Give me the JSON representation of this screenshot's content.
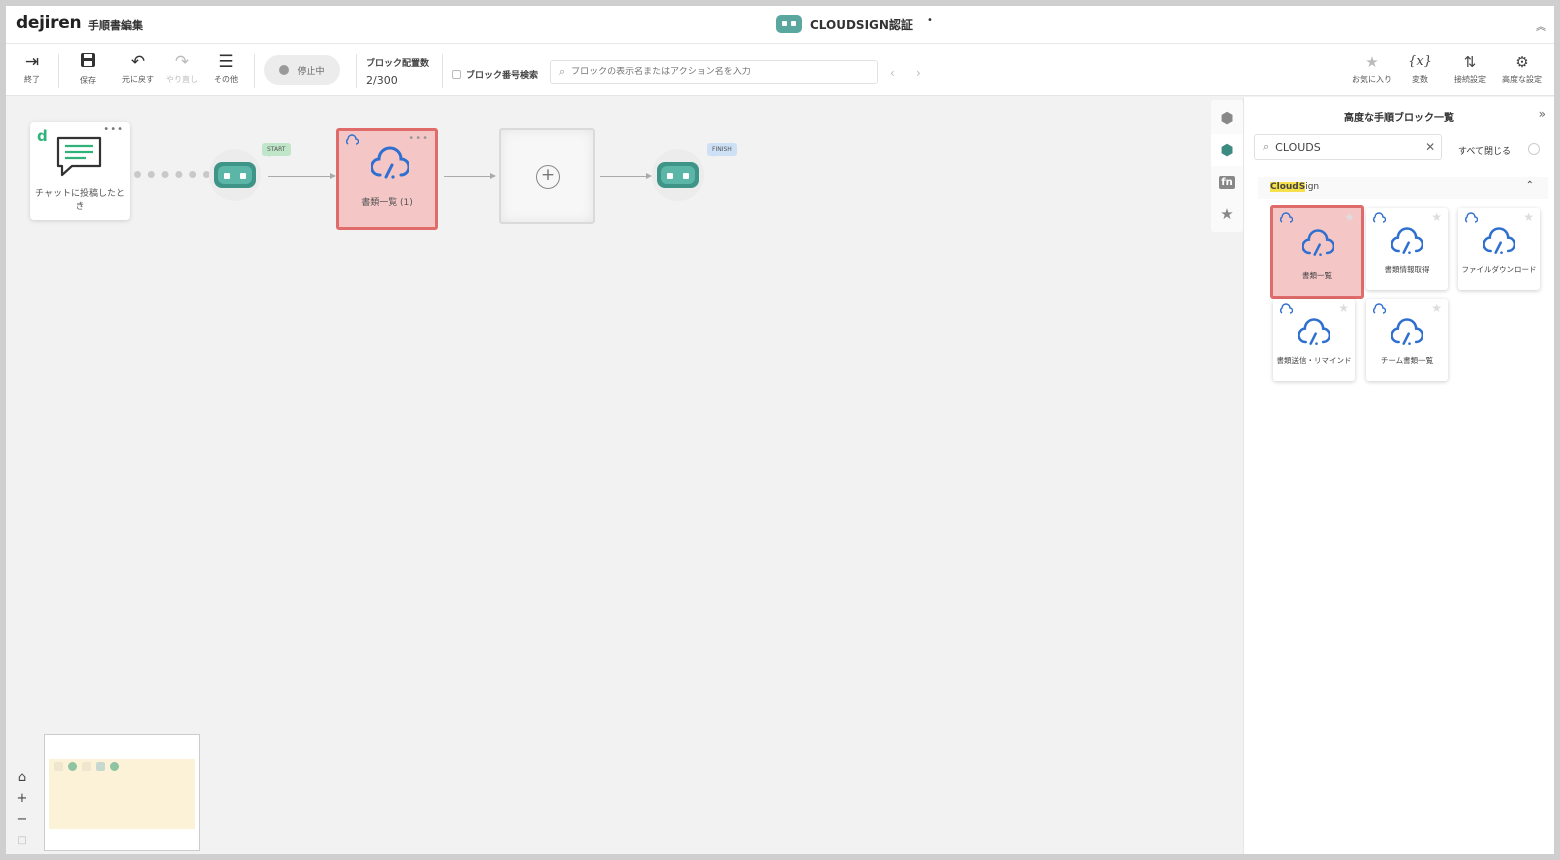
{
  "header": {
    "logo": "dejiren",
    "subtitle": "手順書編集",
    "workflow_title": "CLOUDSIGN認証",
    "unsaved_marker": "•",
    "collapse_icon": "chevron-double-up-icon"
  },
  "toolbar": {
    "exit_label": "終了",
    "save_label": "保存",
    "undo_label": "元に戻す",
    "redo_label": "やり直し",
    "other_label": "その他",
    "status_label": "停止中",
    "block_count_label": "ブロック配置数",
    "block_count_value": "2/300",
    "search_by_number_label": "ブロック番号検索",
    "block_search_placeholder": "ブロックの表示名またはアクション名を入力",
    "favorite_label": "お気に入り",
    "variable_label": "変数",
    "connection_label": "接続設定",
    "advanced_label": "高度な設定"
  },
  "canvas": {
    "trigger_caption": "チャットに投稿したとき",
    "start_tag": "START",
    "finish_tag": "FINISH",
    "doc_node_caption": "書類一覧 (1)",
    "node_menu": "•••"
  },
  "side_tabs": {
    "tab1": "cube-icon",
    "tab2": "cube-stack-icon",
    "tab3_label": "fn",
    "tab4": "star-icon"
  },
  "panel": {
    "title": "高度な手順ブロック一覧",
    "collapse_icon": "chevron-double-right-icon",
    "search_value": "CLOUDS",
    "close_all_label": "すべて閉じる",
    "category": {
      "highlight": "CloudS",
      "rest": "ign"
    },
    "tiles": [
      {
        "label": "書類一覧",
        "selected": true
      },
      {
        "label": "書類情報取得",
        "selected": false
      },
      {
        "label": "ファイルダウンロード",
        "selected": false
      },
      {
        "label": "書類送信・リマインド",
        "selected": false
      },
      {
        "label": "チーム書類一覧",
        "selected": false
      }
    ]
  },
  "colors": {
    "brand_green": "#2fb37a",
    "robot_teal": "#5bb6a8",
    "selected_fill": "#f5c6c6",
    "selected_border": "#e06b6b",
    "cloudsign_blue": "#2f6fd0"
  }
}
